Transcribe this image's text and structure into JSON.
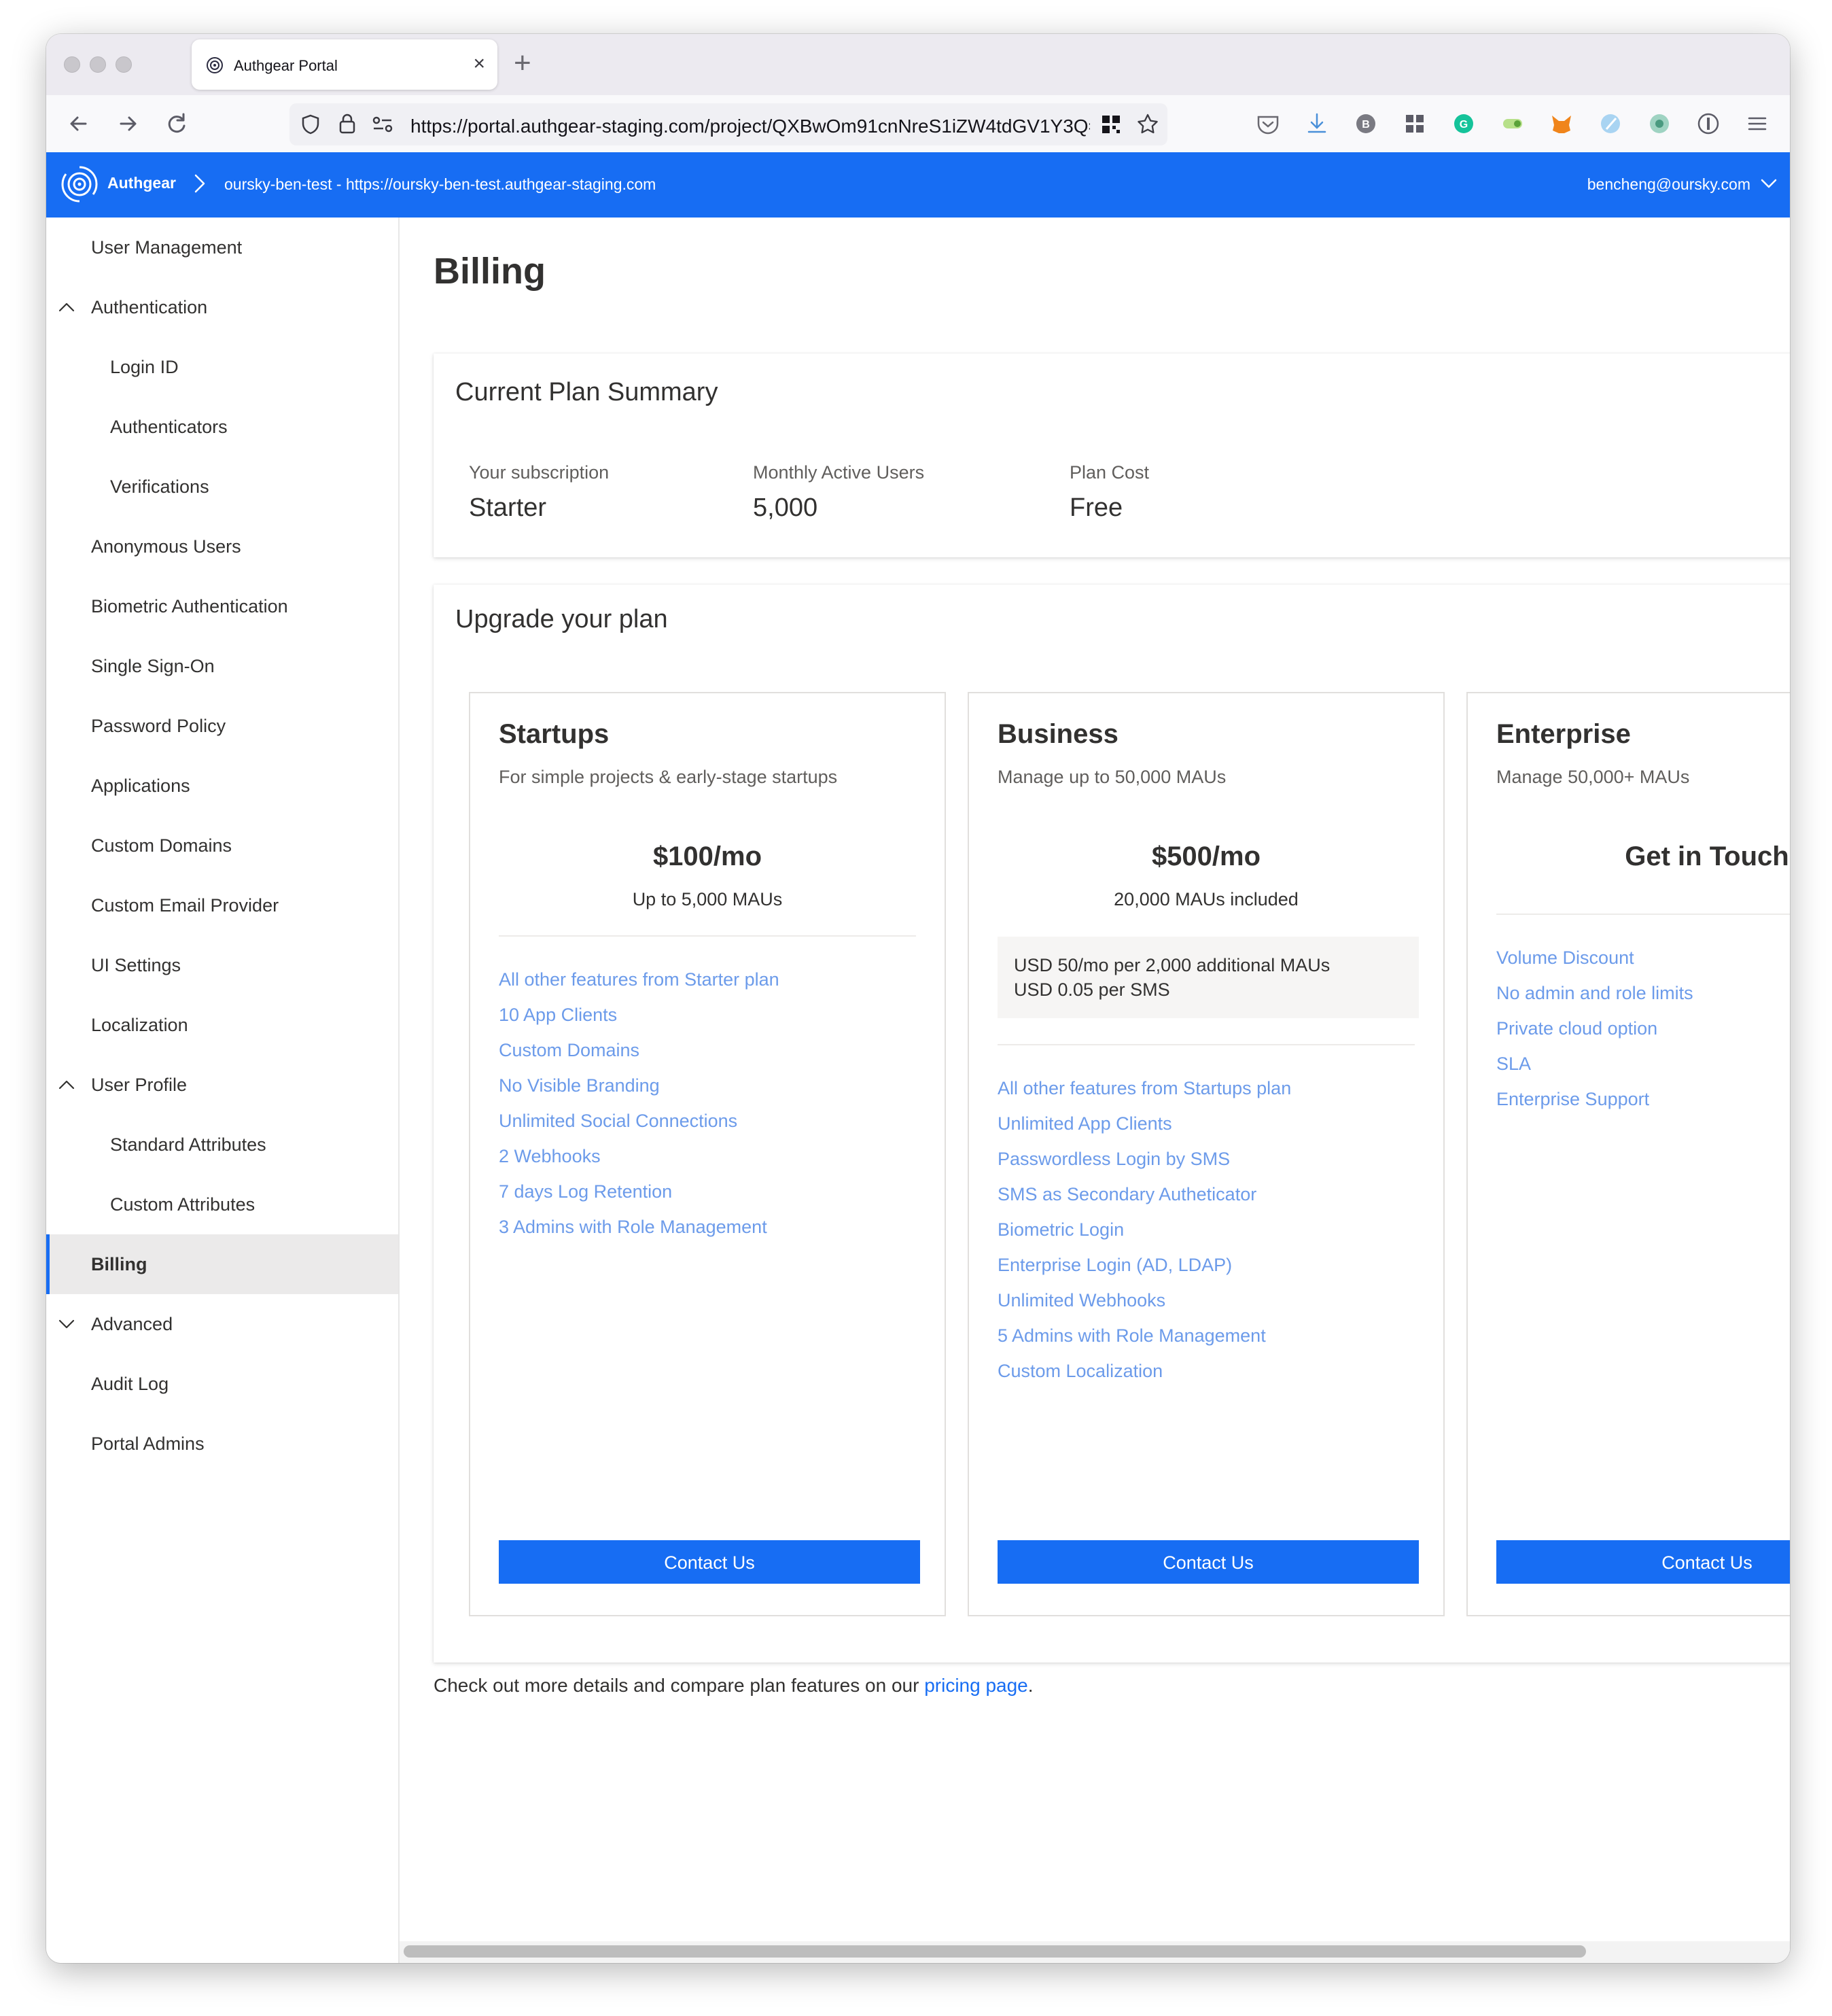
{
  "browser": {
    "tab_title": "Authgear Portal",
    "url": "https://portal.authgear-staging.com/project/QXBwOm91cnNreS1iZW4tdGV1Y3Q="
  },
  "app": {
    "brand": "Authgear",
    "project": "oursky-ben-test - https://oursky-ben-test.authgear-staging.com",
    "user_email": "bencheng@oursky.com",
    "brand_color": "#176df3"
  },
  "sidebar": {
    "items": [
      {
        "label": "User Management"
      },
      {
        "label": "Authentication"
      },
      {
        "label": "Login ID"
      },
      {
        "label": "Authenticators"
      },
      {
        "label": "Verifications"
      },
      {
        "label": "Anonymous Users"
      },
      {
        "label": "Biometric Authentication"
      },
      {
        "label": "Single Sign-On"
      },
      {
        "label": "Password Policy"
      },
      {
        "label": "Applications"
      },
      {
        "label": "Custom Domains"
      },
      {
        "label": "Custom Email Provider"
      },
      {
        "label": "UI Settings"
      },
      {
        "label": "Localization"
      },
      {
        "label": "User Profile"
      },
      {
        "label": "Standard Attributes"
      },
      {
        "label": "Custom Attributes"
      },
      {
        "label": "Billing"
      },
      {
        "label": "Advanced"
      },
      {
        "label": "Audit Log"
      },
      {
        "label": "Portal Admins"
      }
    ]
  },
  "main": {
    "title": "Billing",
    "summary": {
      "title": "Current Plan Summary",
      "subscription_label": "Your subscription",
      "subscription_value": "Starter",
      "mau_label": "Monthly Active Users",
      "mau_value": "5,000",
      "cost_label": "Plan Cost",
      "cost_value": "Free"
    },
    "upgrade": {
      "title": "Upgrade your plan",
      "plans": [
        {
          "name": "Startups",
          "desc": "For simple projects & early-stage startups",
          "price": "$100/mo",
          "note": "Up to 5,000 MAUs",
          "features": [
            "All other features from Starter plan",
            "10 App Clients",
            "Custom Domains",
            "No Visible Branding",
            "Unlimited Social Connections",
            "2 Webhooks",
            "7 days Log Retention",
            "3 Admins with Role Management"
          ],
          "button": "Contact Us"
        },
        {
          "name": "Business",
          "desc": "Manage up to 50,000 MAUs",
          "price": "$500/mo",
          "note": "20,000 MAUs included",
          "extra_line1": "USD 50/mo per 2,000 additional MAUs",
          "extra_line2": "USD 0.05 per SMS",
          "features": [
            "All other features from Startups plan",
            "Unlimited App Clients",
            "Passwordless Login by SMS",
            "SMS as Secondary Autheticator",
            "Biometric Login",
            "Enterprise Login (AD, LDAP)",
            "Unlimited Webhooks",
            "5 Admins with Role Management",
            "Custom Localization"
          ],
          "button": "Contact Us"
        },
        {
          "name": "Enterprise",
          "desc": "Manage 50,000+ MAUs",
          "price": "Get in Touch",
          "features": [
            "Volume Discount",
            "No admin and role limits",
            "Private cloud option",
            "SLA",
            "Enterprise Support"
          ],
          "button": "Contact Us"
        }
      ]
    },
    "footer": {
      "text": "Check out more details and compare plan features on our ",
      "link": "pricing page",
      "suffix": "."
    }
  }
}
